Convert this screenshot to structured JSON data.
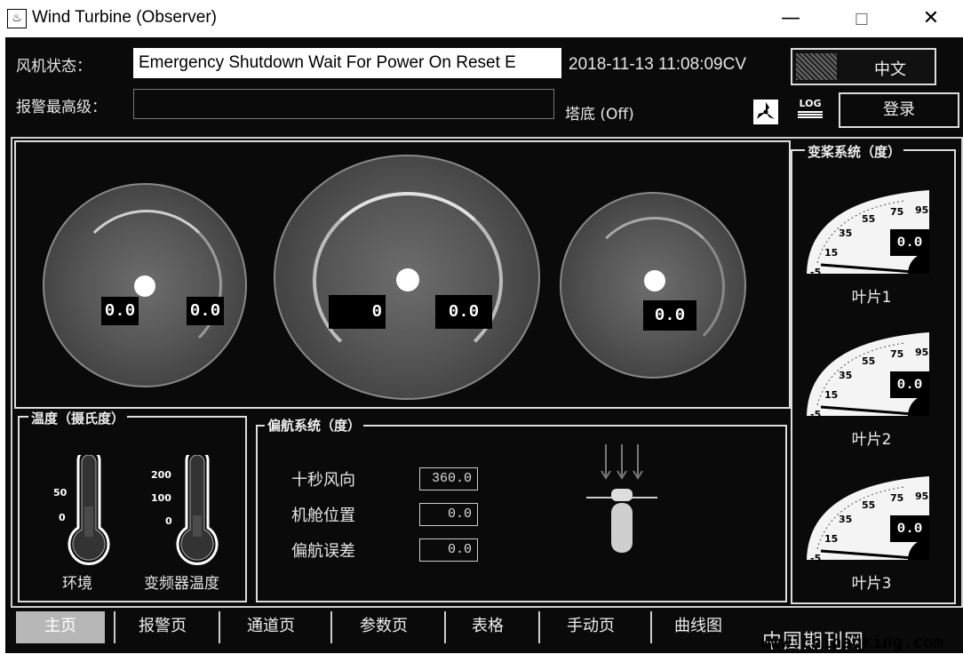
{
  "window": {
    "title": "Wind Turbine (Observer)",
    "minimize": "—",
    "maximize": "☐",
    "close": "✕"
  },
  "header": {
    "status_label": "风机状态：",
    "status_value": "Emergency Shutdown Wait For Power On Reset E",
    "datetime": "2018-11-13 11:08:09CV",
    "mode_button": "中文",
    "alarm_label": "报警最高级：",
    "alarm_value": "",
    "tower_label": "塔底 (Off)",
    "log_icon_text": "LOG",
    "login_button": "登录"
  },
  "gauges": {
    "left": {
      "values": [
        "0.0",
        "0.0"
      ]
    },
    "center": {
      "values": [
        "0",
        "0.0"
      ]
    },
    "right": {
      "values": [
        "0.0"
      ]
    }
  },
  "pitch": {
    "title": "变桨系统（度）",
    "scale_labels": [
      "-5",
      "15",
      "35",
      "55",
      "75",
      "95"
    ],
    "blades": [
      {
        "label": "叶片1",
        "value": "0.0"
      },
      {
        "label": "叶片2",
        "value": "0.0"
      },
      {
        "label": "叶片3",
        "value": "0.0"
      }
    ]
  },
  "temperature": {
    "title": "温度（摄氏度）",
    "ambient": {
      "label": "环境",
      "ticks": [
        "50",
        "0"
      ]
    },
    "converter": {
      "label": "变频器温度",
      "ticks": [
        "200",
        "100",
        "0"
      ]
    }
  },
  "yaw": {
    "title": "偏航系统（度）",
    "rows": [
      {
        "label": "十秒风向",
        "value": "360.0"
      },
      {
        "label": "机舱位置",
        "value": "0.0"
      },
      {
        "label": "偏航误差",
        "value": "0.0"
      }
    ]
  },
  "tabs": [
    "主页",
    "报警页",
    "通道页",
    "参数页",
    "表格",
    "手动页",
    "曲线图"
  ],
  "watermark": {
    "line1": "中国期刊网",
    "line2": "www.chinaqking.com"
  }
}
